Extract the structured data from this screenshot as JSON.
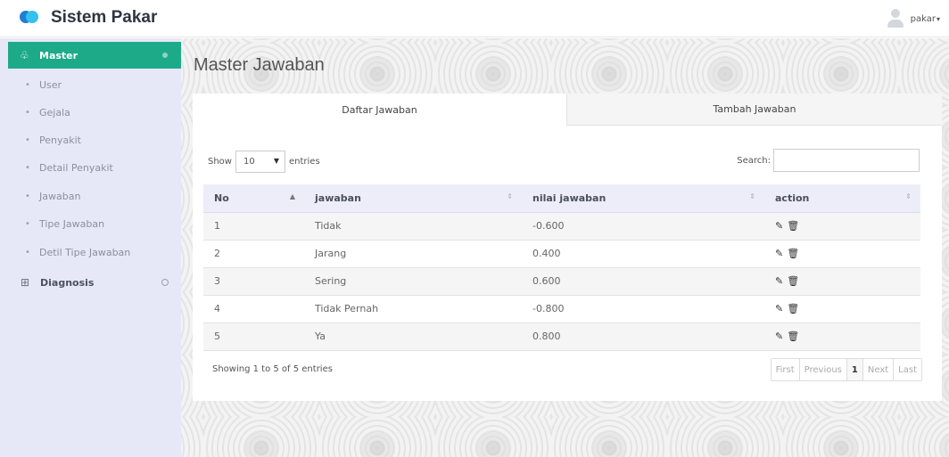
{
  "app": {
    "title": "Sistem Pakar"
  },
  "user": {
    "name": "pakar"
  },
  "sidebar": {
    "master": {
      "label": "Master"
    },
    "items": [
      {
        "label": "User"
      },
      {
        "label": "Gejala"
      },
      {
        "label": "Penyakit"
      },
      {
        "label": "Detail Penyakit"
      },
      {
        "label": "Jawaban"
      },
      {
        "label": "Tipe Jawaban"
      },
      {
        "label": "Detil Tipe Jawaban"
      }
    ],
    "diagnosis": {
      "label": "Diagnosis"
    }
  },
  "page": {
    "title": "Master Jawaban"
  },
  "tabs": [
    {
      "label": "Daftar Jawaban",
      "active": true
    },
    {
      "label": "Tambah Jawaban",
      "active": false
    }
  ],
  "table_controls": {
    "show_label": "Show",
    "entries_value": "10",
    "entries_label": "entries",
    "search_label": "Search:",
    "search_value": ""
  },
  "table": {
    "columns": [
      "No",
      "jawaban",
      "nilai jawaban",
      "action"
    ],
    "rows": [
      {
        "no": "1",
        "jawaban": "Tidak",
        "nilai": "-0.600"
      },
      {
        "no": "2",
        "jawaban": "Jarang",
        "nilai": "0.400"
      },
      {
        "no": "3",
        "jawaban": "Sering",
        "nilai": "0.600"
      },
      {
        "no": "4",
        "jawaban": "Tidak Pernah",
        "nilai": "-0.800"
      },
      {
        "no": "5",
        "jawaban": "Ya",
        "nilai": "0.800"
      }
    ]
  },
  "footer": {
    "info": "Showing 1 to 5 of 5 entries",
    "pagination": {
      "first": "First",
      "previous": "Previous",
      "current": "1",
      "next": "Next",
      "last": "Last"
    }
  },
  "colors": {
    "accent": "#1daa89",
    "sidebar_bg": "#e6e8f7",
    "logo_dark": "#1f7fd1",
    "logo_light": "#35c0ef"
  },
  "icons": {
    "edit": "edit-icon",
    "delete": "trash-icon",
    "master": "leaf-icon",
    "diagnosis": "grid-icon"
  }
}
